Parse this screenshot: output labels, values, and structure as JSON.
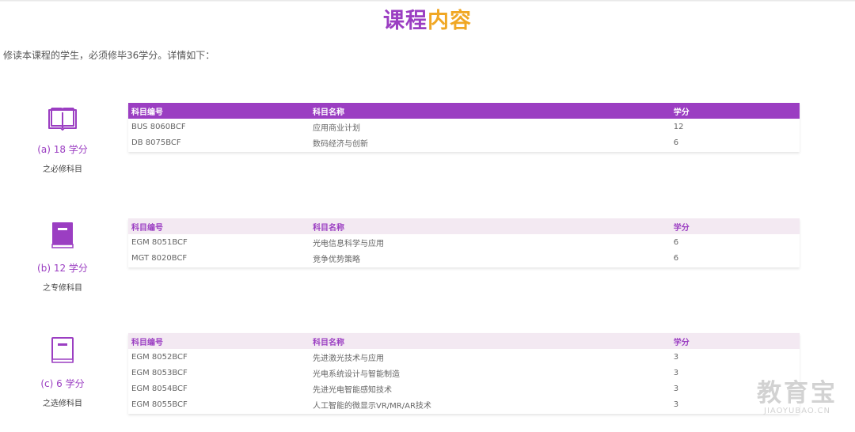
{
  "title": {
    "part1": "课程",
    "part2": "内容"
  },
  "intro": "修读本课程的学生，必须修毕36学分。详情如下：",
  "headers": {
    "code": "科目编号",
    "name": "科目名称",
    "credit": "学分"
  },
  "sections": [
    {
      "icon": "open-book-icon",
      "credits_label": "(a) 18 学分",
      "kind_label": "之必修科目",
      "rows": [
        {
          "code": "BUS 8060BCF",
          "name": "应用商业计划",
          "credit": "12"
        },
        {
          "code": "DB 8075BCF",
          "name": "数码经济与创新",
          "credit": "6"
        }
      ]
    },
    {
      "icon": "closed-book-icon",
      "credits_label": "(b) 12 学分",
      "kind_label": "之专修科目",
      "rows": [
        {
          "code": "EGM 8051BCF",
          "name": "光电信息科学与应用",
          "credit": "6"
        },
        {
          "code": "MGT 8020BCF",
          "name": "竞争优势策略",
          "credit": "6"
        }
      ]
    },
    {
      "icon": "book-outline-icon",
      "credits_label": "(c) 6 学分",
      "kind_label": "之选修科目",
      "rows": [
        {
          "code": "EGM 8052BCF",
          "name": "先进激光技术与应用",
          "credit": "3"
        },
        {
          "code": "EGM 8053BCF",
          "name": "光电系统设计与智能制造",
          "credit": "3"
        },
        {
          "code": "EGM 8054BCF",
          "name": "先进光电智能感知技术",
          "credit": "3"
        },
        {
          "code": "EGM 8055BCF",
          "name": "人工智能的微显示VR/MR/AR技术",
          "credit": "3"
        }
      ]
    }
  ],
  "watermark": {
    "cn": "教育宝",
    "en": "JIAOYUBAO.CN"
  },
  "colors": {
    "purple": "#9b3ec2",
    "orange": "#f0a724",
    "header_light": "#f3e9f2"
  }
}
